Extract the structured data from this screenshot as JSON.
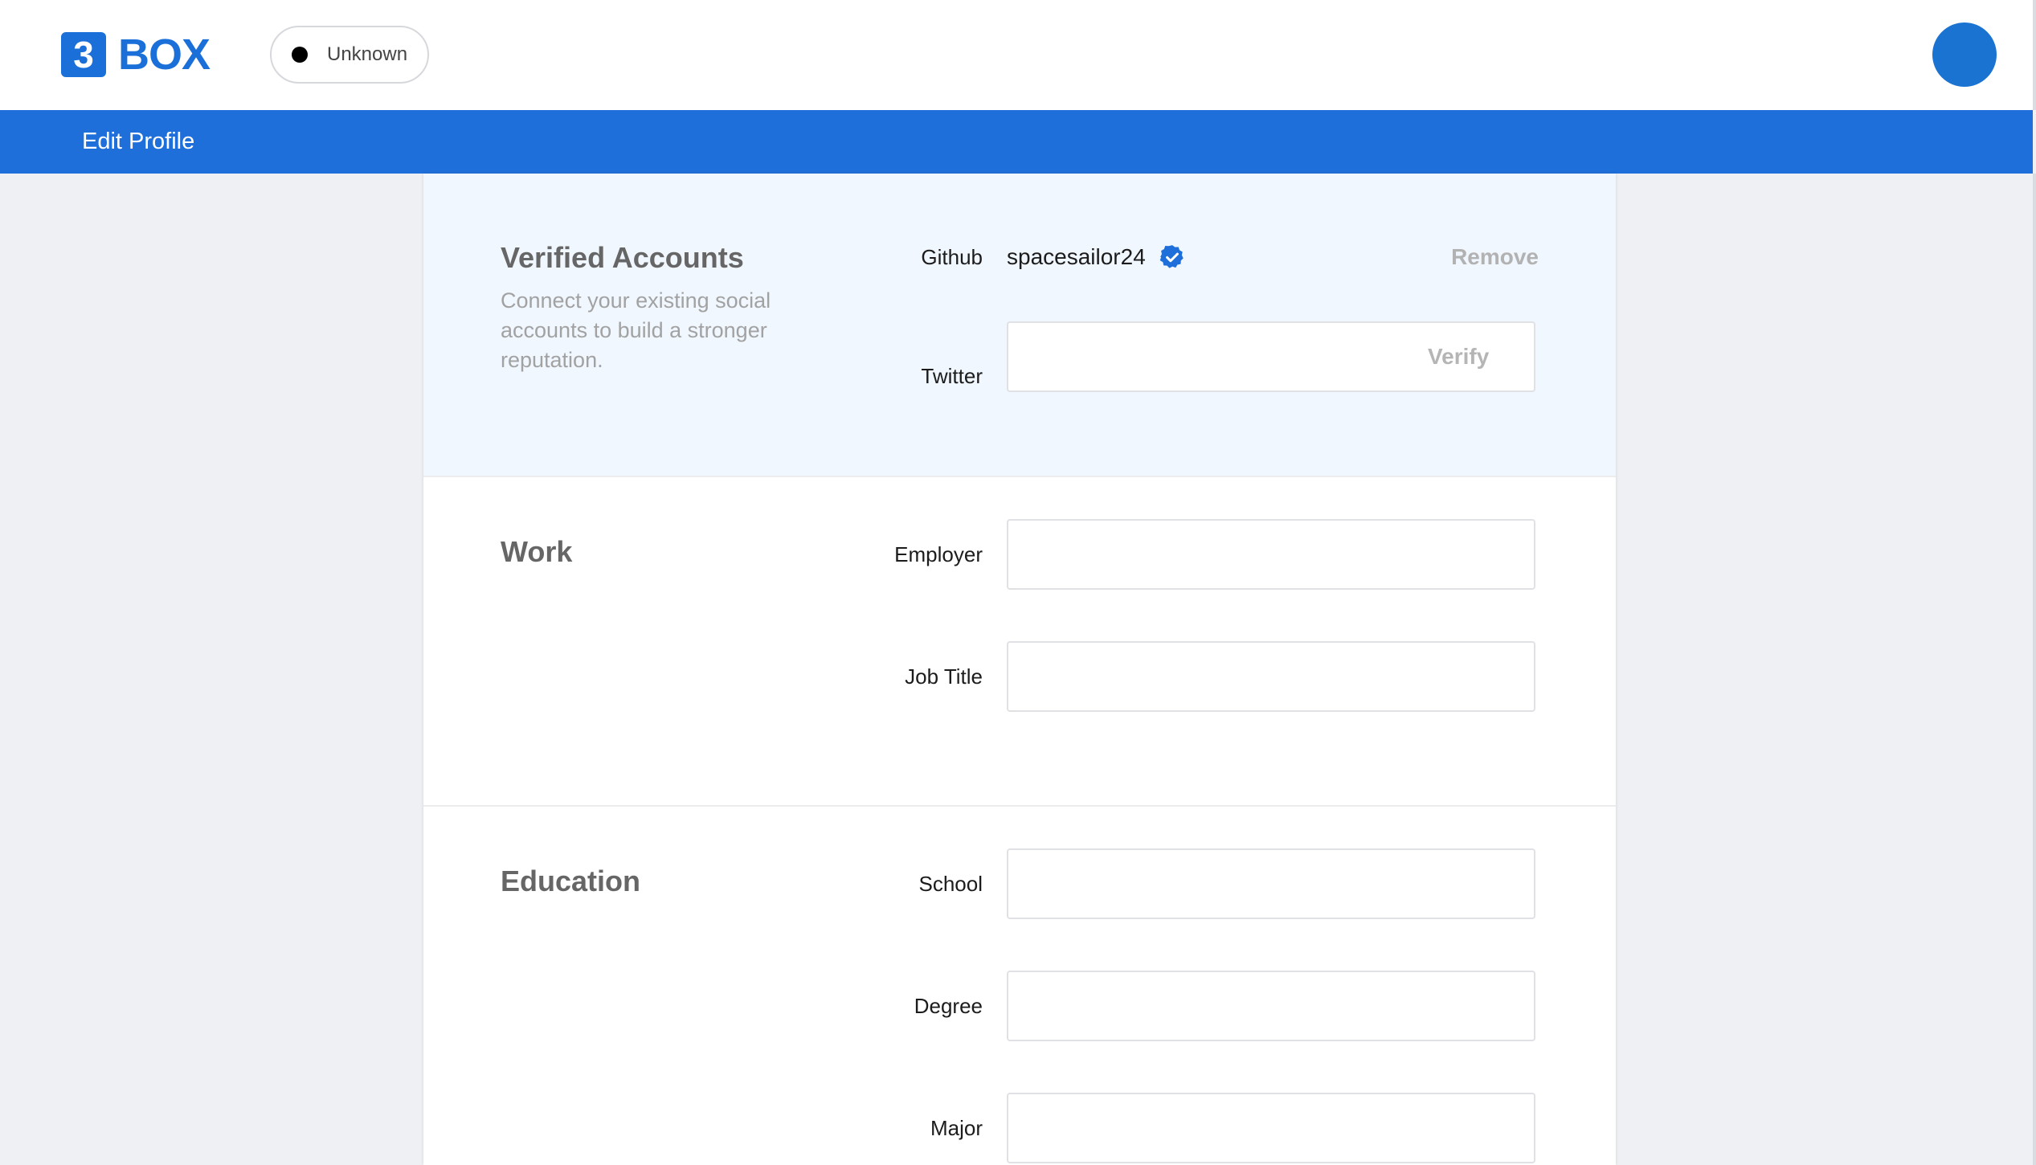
{
  "header": {
    "logo_number": "3",
    "logo_text": "BOX",
    "status_label": "Unknown"
  },
  "nav": {
    "title": "Edit Profile"
  },
  "sections": {
    "verified": {
      "title": "Verified Accounts",
      "description": "Connect your existing social accounts to build a stronger reputation.",
      "github_label": "Github",
      "github_username": "spacesailor24",
      "remove_label": "Remove",
      "twitter_label": "Twitter",
      "twitter_value": "",
      "verify_label": "Verify"
    },
    "work": {
      "title": "Work",
      "employer_label": "Employer",
      "employer_value": "",
      "job_title_label": "Job Title",
      "job_title_value": ""
    },
    "education": {
      "title": "Education",
      "school_label": "School",
      "school_value": "",
      "degree_label": "Degree",
      "degree_value": "",
      "major_label": "Major",
      "major_value": ""
    }
  },
  "colors": {
    "brand_blue": "#1f6fdb",
    "verified_bg": "#f0f7ff",
    "page_bg": "#eef0f3"
  },
  "icons": {
    "verified": "verified-badge-icon",
    "status": "status-dot-icon"
  }
}
